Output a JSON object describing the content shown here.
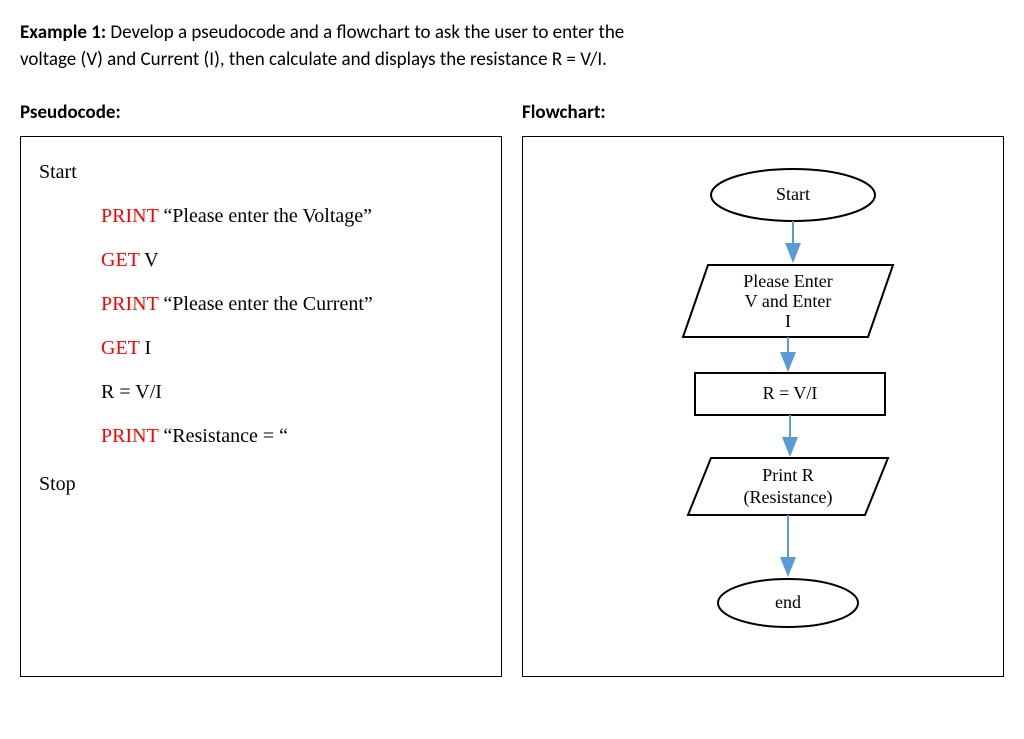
{
  "prompt": {
    "label": "Example 1:",
    "text_line1": " Develop a pseudocode and a flowchart to ask the user to enter the",
    "text_line2": "voltage (V) and Current (I), then calculate and displays the resistance R = V/I."
  },
  "headings": {
    "pseudocode": "Pseudocode:",
    "flowchart": "Flowchart:"
  },
  "pseudocode": {
    "start": "Start",
    "stop": "Stop",
    "l1_kw": "PRINT",
    "l1_txt": " “Please enter the Voltage”",
    "l2_kw": "GET",
    "l2_txt": " V",
    "l3_kw": "PRINT",
    "l3_txt": " “Please enter the Current”",
    "l4_kw": "GET",
    "l4_txt": " I",
    "l5_txt": "R = V/I",
    "l6_kw": "PRINT",
    "l6_txt": " “Resistance = “"
  },
  "flowchart": {
    "start": "Start",
    "input_l1": "Please Enter",
    "input_l2": "V and Enter",
    "input_l3": "I",
    "process": "R = V/I",
    "output_l1": "Print R",
    "output_l2": "(Resistance)",
    "end": "end"
  }
}
